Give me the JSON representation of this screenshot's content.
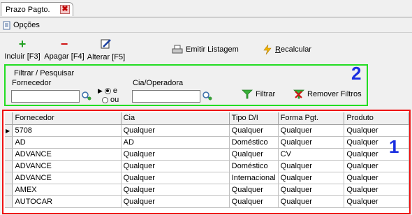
{
  "tab": {
    "label": "Prazo Pagto."
  },
  "menu": {
    "options_label": "Opções"
  },
  "toolbar": {
    "include_label": "Incluir [F3]",
    "delete_label": "Apagar [F4]",
    "edit_label": "Alterar [F5]",
    "print_label": "Emitir Listagem",
    "recalc_label": "Recalcular"
  },
  "filter": {
    "title": "Filtrar / Pesquisar",
    "supplier_label": "Fornecedor",
    "supplier_value": "",
    "radio_and": "e",
    "radio_or": "ou",
    "selected_logic": "e",
    "cia_label": "Cia/Operadora",
    "cia_value": "",
    "filter_button": "Filtrar",
    "remove_button": "Remover Filtros"
  },
  "annotations": {
    "filter_number": "2",
    "grid_number": "1"
  },
  "colors": {
    "filter_box_border": "#22dd22",
    "grid_box_border": "#ee1111",
    "annotation_text": "#1a2fe0"
  },
  "grid": {
    "columns": [
      "Fornecedor",
      "Cia",
      "Tipo D/I",
      "Forma Pgt.",
      "Produto"
    ],
    "rows": [
      [
        "5708",
        "Qualquer",
        "Qualquer",
        "Qualquer",
        "Qualquer"
      ],
      [
        "AD",
        "AD",
        "Doméstico",
        "Qualquer",
        "Qualquer"
      ],
      [
        "ADVANCE",
        "Qualquer",
        "Qualquer",
        "CV",
        "Qualquer"
      ],
      [
        "ADVANCE",
        "Qualquer",
        "Doméstico",
        "Qualquer",
        "Qualquer"
      ],
      [
        "ADVANCE",
        "Qualquer",
        "Internacional",
        "Qualquer",
        "Qualquer"
      ],
      [
        "AMEX",
        "Qualquer",
        "Qualquer",
        "Qualquer",
        "Qualquer"
      ],
      [
        "AUTOCAR",
        "Qualquer",
        "Qualquer",
        "Qualquer",
        "Qualquer"
      ]
    ]
  }
}
